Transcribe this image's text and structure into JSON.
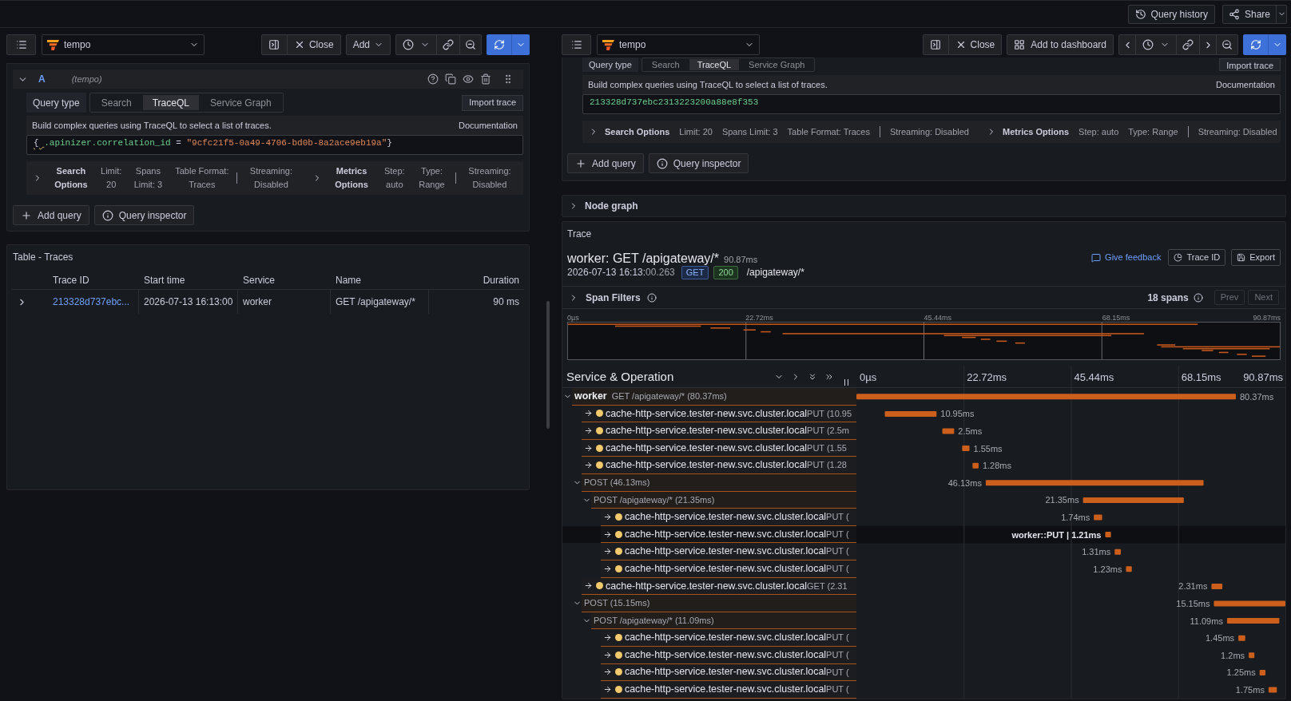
{
  "top_bar": {
    "actions": [
      {
        "kind": "history",
        "label": "Query history"
      },
      {
        "kind": "share",
        "label": "Share"
      }
    ]
  },
  "left_pane": {
    "toolbar": {
      "datasource": "tempo",
      "groups": [
        [
          {
            "kind": "split"
          },
          {
            "kind": "close",
            "label": "Close"
          }
        ],
        [
          {
            "kind": "add",
            "label": "Add"
          }
        ],
        [
          {
            "kind": "time"
          },
          {
            "kind": "link"
          },
          {
            "kind": "zoom_out"
          }
        ],
        [
          {
            "kind": "run"
          },
          {
            "kind": "run_menu"
          }
        ]
      ]
    },
    "query": {
      "header": {
        "expanded": true,
        "letter": "A",
        "datasource": "(tempo)"
      },
      "query_type": {
        "label": "Query type",
        "options": [
          {
            "label": "Search",
            "selected": false
          },
          {
            "label": "TraceQL",
            "selected": true
          },
          {
            "label": "Service Graph",
            "selected": false
          }
        ]
      },
      "import_label": "Import trace",
      "description": "Build complex queries using TraceQL to select a list of traces.",
      "documentation": "Documentation",
      "editor_tokens": [
        {
          "kind": "punctuation",
          "text": "{ ",
          "warning": true
        },
        {
          "kind": "attribute",
          "text": ".apinizer.correlation_id",
          "warning": false
        },
        {
          "kind": "operator",
          "text": " = ",
          "warning": false
        },
        {
          "kind": "string",
          "text": "\"9cfc21f5-0a49-4706-bd0b-8a2ace9eb19a\"",
          "warning": false
        },
        {
          "kind": "punctuation",
          "text": "}",
          "warning": false
        }
      ],
      "option_groups": [
        {
          "title": "Search Options",
          "expanded": false,
          "items": [
            "Limit: 20",
            "Spans Limit: 3",
            "Table Format: Traces"
          ],
          "after_divider": [
            "Streaming: Disabled"
          ]
        },
        {
          "title": "Metrics Options",
          "expanded": false,
          "items": [
            "Step: auto",
            "Type: Range"
          ],
          "after_divider": [
            "Streaming: Disabled"
          ]
        }
      ],
      "actions": [
        {
          "kind": "add",
          "label": "Add query"
        },
        {
          "kind": "inspect",
          "label": "Query inspector"
        }
      ]
    },
    "table": {
      "title": "Table - Traces",
      "columns": [
        "Trace ID",
        "Start time",
        "Service",
        "Name",
        "Duration"
      ],
      "rows": [
        {
          "expanded": false,
          "cells": [
            "213328d737ebc...",
            "2026-07-13 16:13:00",
            "worker",
            "GET /apigateway/*",
            "90 ms"
          ]
        }
      ]
    }
  },
  "right_pane": {
    "toolbar": {
      "datasource": "tempo",
      "groups": [
        [
          {
            "kind": "split"
          },
          {
            "kind": "close",
            "label": "Close"
          }
        ],
        [
          {
            "kind": "add_dashboard",
            "label": "Add to dashboard"
          }
        ],
        [
          {
            "kind": "prev"
          },
          {
            "kind": "time"
          },
          {
            "kind": "link"
          },
          {
            "kind": "next"
          },
          {
            "kind": "zoom_out"
          }
        ],
        [
          {
            "kind": "run"
          },
          {
            "kind": "run_menu"
          }
        ]
      ]
    },
    "query": {
      "query_type": {
        "label": "Query type",
        "options": [
          {
            "label": "Search",
            "selected": false
          },
          {
            "label": "TraceQL",
            "selected": true
          },
          {
            "label": "Service Graph",
            "selected": false
          }
        ]
      },
      "import_label": "Import trace",
      "description": "Build complex queries using TraceQL to select a list of traces.",
      "documentation": "Documentation",
      "editor_tokens": [
        {
          "kind": "identifier",
          "text": "213328d737ebc2313223200a88e8f353",
          "warning": false
        }
      ],
      "option_groups": [
        {
          "title": "Search Options",
          "expanded": false,
          "items": [
            "Limit: 20",
            "Spans Limit: 3",
            "Table Format: Traces"
          ],
          "after_divider": [
            "Streaming: Disabled"
          ]
        },
        {
          "title": "Metrics Options",
          "expanded": false,
          "items": [
            "Step: auto",
            "Type: Range"
          ],
          "after_divider": [
            "Streaming: Disabled"
          ]
        }
      ],
      "actions": [
        {
          "kind": "add",
          "label": "Add query"
        },
        {
          "kind": "inspect",
          "label": "Query inspector"
        }
      ]
    },
    "node_graph": {
      "title": "Node graph",
      "expanded": false
    },
    "trace": {
      "panel_title": "Trace",
      "title": "worker: GET /apigateway/*",
      "duration": "90.87ms",
      "start_time": "2026-07-13 16:13:",
      "start_time_fraction": "00.263",
      "method": "GET",
      "status": "200",
      "path": "/apigateway/*",
      "actions": [
        {
          "kind": "feedback",
          "label": "Give feedback"
        },
        {
          "kind": "trace_id",
          "label": "Trace ID"
        },
        {
          "kind": "export",
          "label": "Export"
        }
      ],
      "span_filters": {
        "label": "Span Filters",
        "expanded": false,
        "count": "18 spans",
        "buttons": [
          {
            "label": "Prev",
            "disabled": true
          },
          {
            "label": "Next",
            "disabled": true
          }
        ]
      },
      "minimap": {
        "ticks": [
          "0µs",
          "22.72ms",
          "45.44ms",
          "68.15ms",
          "90.87ms"
        ]
      },
      "timeline": {
        "header": "Service & Operation",
        "ticks": [
          "0µs",
          "22.72ms",
          "45.44ms",
          "68.15ms",
          "90.87ms"
        ]
      },
      "spans": [
        {
          "kind": "root",
          "service": "worker",
          "operation": "GET /apigateway/* (80.37ms)",
          "duration_label": "80.37ms",
          "expanded": true,
          "hovered": false,
          "children": [
            {
              "kind": "leaf",
              "service": "cache-http-service.tester-new.svc.cluster.local",
              "operation": "PUT (10.95",
              "duration_label": "10.95ms",
              "hovered": false
            },
            {
              "kind": "leaf",
              "service": "cache-http-service.tester-new.svc.cluster.local",
              "operation": "PUT (2.5m",
              "duration_label": "2.5ms",
              "hovered": false
            },
            {
              "kind": "leaf",
              "service": "cache-http-service.tester-new.svc.cluster.local",
              "operation": "PUT (1.55",
              "duration_label": "1.55ms",
              "hovered": false
            },
            {
              "kind": "leaf",
              "service": "cache-http-service.tester-new.svc.cluster.local",
              "operation": "PUT (1.28",
              "duration_label": "1.28ms",
              "hovered": false
            },
            {
              "kind": "group",
              "operation": "POST (46.13ms)",
              "duration_label": "46.13ms",
              "expanded": true,
              "hovered": false,
              "children": [
                {
                  "kind": "group",
                  "operation": "POST /apigateway/* (21.35ms)",
                  "duration_label": "21.35ms",
                  "expanded": true,
                  "hovered": false,
                  "children": [
                    {
                      "kind": "leaf",
                      "service": "cache-http-service.tester-new.svc.cluster.local",
                      "operation": "PUT (",
                      "duration_label": "1.74ms",
                      "hovered": false
                    },
                    {
                      "kind": "leaf",
                      "service": "cache-http-service.tester-new.svc.cluster.local",
                      "operation": "PUT (",
                      "duration_label": "worker::PUT | 1.21ms",
                      "hovered": true
                    },
                    {
                      "kind": "leaf",
                      "service": "cache-http-service.tester-new.svc.cluster.local",
                      "operation": "PUT (",
                      "duration_label": "1.31ms",
                      "hovered": false
                    },
                    {
                      "kind": "leaf",
                      "service": "cache-http-service.tester-new.svc.cluster.local",
                      "operation": "PUT (",
                      "duration_label": "1.23ms",
                      "hovered": false
                    }
                  ]
                }
              ]
            },
            {
              "kind": "leaf",
              "service": "cache-http-service.tester-new.svc.cluster.local",
              "operation": "GET (2.31",
              "duration_label": "2.31ms",
              "hovered": false
            },
            {
              "kind": "group",
              "operation": "POST (15.15ms)",
              "duration_label": "15.15ms",
              "expanded": true,
              "hovered": false,
              "children": [
                {
                  "kind": "group",
                  "operation": "POST /apigateway/* (11.09ms)",
                  "duration_label": "11.09ms",
                  "expanded": true,
                  "hovered": false,
                  "children": [
                    {
                      "kind": "leaf",
                      "service": "cache-http-service.tester-new.svc.cluster.local",
                      "operation": "PUT (",
                      "duration_label": "1.45ms",
                      "hovered": false
                    },
                    {
                      "kind": "leaf",
                      "service": "cache-http-service.tester-new.svc.cluster.local",
                      "operation": "PUT (",
                      "duration_label": "1.2ms",
                      "hovered": false
                    },
                    {
                      "kind": "leaf",
                      "service": "cache-http-service.tester-new.svc.cluster.local",
                      "operation": "PUT (",
                      "duration_label": "1.25ms",
                      "hovered": false
                    },
                    {
                      "kind": "leaf",
                      "service": "cache-http-service.tester-new.svc.cluster.local",
                      "operation": "PUT (",
                      "duration_label": "1.75ms",
                      "hovered": false
                    }
                  ]
                }
              ]
            }
          ]
        }
      ]
    }
  }
}
